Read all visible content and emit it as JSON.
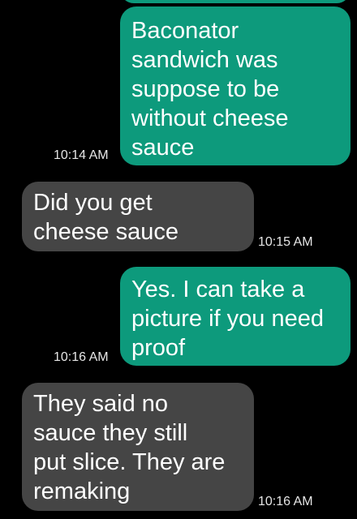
{
  "conversation": {
    "messages": [
      {
        "direction": "outgoing",
        "text": "Baconator\nsandwich was\nsuppose to be\nwithout cheese\nsauce",
        "time": "10:14 AM"
      },
      {
        "direction": "incoming",
        "text": "Did you get\ncheese sauce",
        "time": "10:15 AM"
      },
      {
        "direction": "outgoing",
        "text": "Yes. I can take a\npicture if you need\nproof",
        "time": "10:16 AM"
      },
      {
        "direction": "incoming",
        "text": "They said no\nsauce they still\nput slice. They are\nremaking",
        "time": "10:16 AM"
      }
    ]
  },
  "colors": {
    "background": "#000000",
    "outgoing_bubble": "#0d9a7c",
    "incoming_bubble": "#454545",
    "bubble_text": "#ffffff",
    "timestamp_text": "#e6e6e6"
  }
}
